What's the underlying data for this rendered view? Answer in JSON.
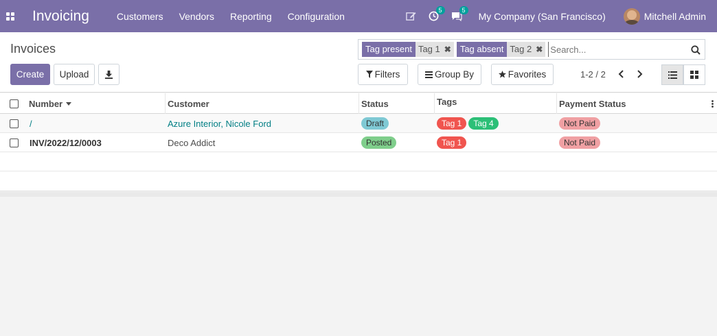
{
  "navbar": {
    "app_title": "Invoicing",
    "menu": [
      "Customers",
      "Vendors",
      "Reporting",
      "Configuration"
    ],
    "activity_count": "5",
    "messages_count": "5",
    "company": "My Company (San Francisco)",
    "user": "Mitchell Admin"
  },
  "control": {
    "title": "Invoices",
    "create_label": "Create",
    "upload_label": "Upload",
    "search": {
      "facets": [
        {
          "label": "Tag present",
          "value": "Tag 1"
        },
        {
          "label": "Tag absent",
          "value": "Tag 2"
        }
      ],
      "placeholder": "Search..."
    },
    "filters_label": "Filters",
    "groupby_label": "Group By",
    "favorites_label": "Favorites",
    "pager": "1-2 / 2"
  },
  "table": {
    "columns": [
      "Number",
      "Customer",
      "Status",
      "Tags",
      "Payment Status"
    ],
    "rows": [
      {
        "number": "/",
        "customer": "Azure Interior, Nicole Ford",
        "status": "Draft",
        "tags": [
          "Tag 1",
          "Tag 4"
        ],
        "payment": "Not Paid"
      },
      {
        "number": "INV/2022/12/0003",
        "customer": "Deco Addict",
        "status": "Posted",
        "tags": [
          "Tag 1"
        ],
        "payment": "Not Paid"
      }
    ]
  },
  "colors": {
    "brand": "#7a6fa8",
    "draft": "#7fc9d4",
    "posted": "#7fce8b",
    "tag1": "#f0554f",
    "tag4": "#2cbf77",
    "not_paid": "#f0a0a3",
    "link": "#017e84"
  }
}
